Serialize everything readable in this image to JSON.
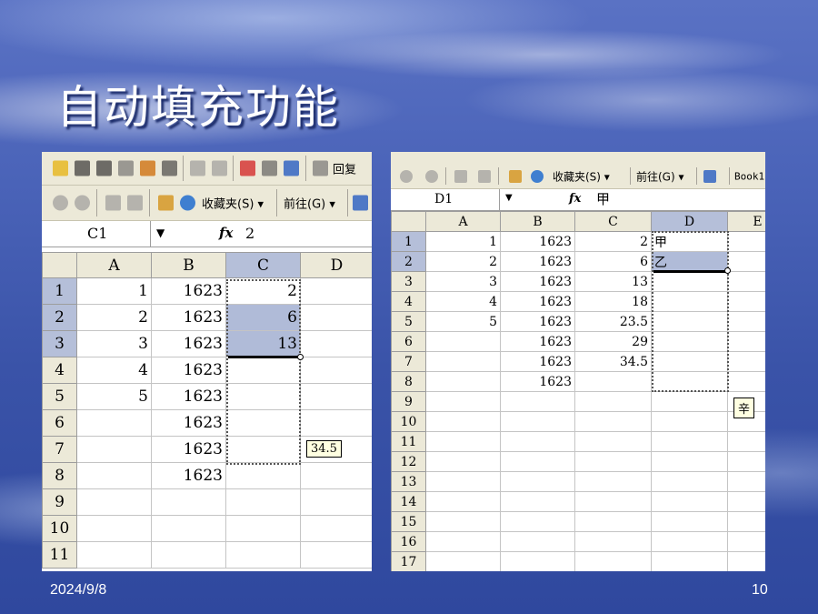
{
  "slide": {
    "title": "自动填充功能",
    "date": "2024/9/8",
    "page_number": "10"
  },
  "left_sheet": {
    "toolbar_icons": [
      "folder-icon",
      "save-icon",
      "permission-icon",
      "mail-icon",
      "print-icon",
      "preview-icon",
      "undo-icon",
      "redo-icon",
      "spellcheck-icon",
      "paste-icon",
      "table-icon",
      "reply-icon"
    ],
    "toolbar_text_right": "回复",
    "web_toolbar": {
      "favorites": "收藏夹(S) ▾",
      "goto": "前往(G) ▾"
    },
    "name_box": "C1",
    "formula_value": "2",
    "columns": [
      "A",
      "B",
      "C",
      "D"
    ],
    "rows": [
      {
        "n": "1",
        "a": "1",
        "b": "1623",
        "c": "2"
      },
      {
        "n": "2",
        "a": "2",
        "b": "1623",
        "c": "6"
      },
      {
        "n": "3",
        "a": "3",
        "b": "1623",
        "c": "13"
      },
      {
        "n": "4",
        "a": "4",
        "b": "1623",
        "c": ""
      },
      {
        "n": "5",
        "a": "5",
        "b": "1623",
        "c": ""
      },
      {
        "n": "6",
        "a": "",
        "b": "1623",
        "c": ""
      },
      {
        "n": "7",
        "a": "",
        "b": "1623",
        "c": ""
      },
      {
        "n": "8",
        "a": "",
        "b": "1623",
        "c": ""
      },
      {
        "n": "9",
        "a": "",
        "b": "",
        "c": ""
      },
      {
        "n": "10",
        "a": "",
        "b": "",
        "c": ""
      },
      {
        "n": "11",
        "a": "",
        "b": "",
        "c": ""
      }
    ],
    "fill_tooltip": "34.5"
  },
  "right_sheet": {
    "web_toolbar": {
      "favorites": "收藏夹(S) ▾",
      "goto": "前往(G) ▾",
      "book": "Book1"
    },
    "name_box": "D1",
    "formula_value": "甲",
    "columns": [
      "A",
      "B",
      "C",
      "D",
      "E"
    ],
    "rows": [
      {
        "n": "1",
        "a": "1",
        "b": "1623",
        "c": "2",
        "d": "甲"
      },
      {
        "n": "2",
        "a": "2",
        "b": "1623",
        "c": "6",
        "d": "乙"
      },
      {
        "n": "3",
        "a": "3",
        "b": "1623",
        "c": "13",
        "d": ""
      },
      {
        "n": "4",
        "a": "4",
        "b": "1623",
        "c": "18",
        "d": ""
      },
      {
        "n": "5",
        "a": "5",
        "b": "1623",
        "c": "23.5",
        "d": ""
      },
      {
        "n": "6",
        "a": "",
        "b": "1623",
        "c": "29",
        "d": ""
      },
      {
        "n": "7",
        "a": "",
        "b": "1623",
        "c": "34.5",
        "d": ""
      },
      {
        "n": "8",
        "a": "",
        "b": "1623",
        "c": "",
        "d": ""
      },
      {
        "n": "9",
        "a": "",
        "b": "",
        "c": "",
        "d": ""
      },
      {
        "n": "10",
        "a": "",
        "b": "",
        "c": "",
        "d": ""
      },
      {
        "n": "11",
        "a": "",
        "b": "",
        "c": "",
        "d": ""
      },
      {
        "n": "12",
        "a": "",
        "b": "",
        "c": "",
        "d": ""
      },
      {
        "n": "13",
        "a": "",
        "b": "",
        "c": "",
        "d": ""
      },
      {
        "n": "14",
        "a": "",
        "b": "",
        "c": "",
        "d": ""
      },
      {
        "n": "15",
        "a": "",
        "b": "",
        "c": "",
        "d": ""
      },
      {
        "n": "16",
        "a": "",
        "b": "",
        "c": "",
        "d": ""
      },
      {
        "n": "17",
        "a": "",
        "b": "",
        "c": "",
        "d": ""
      }
    ],
    "fill_tooltip": "辛"
  }
}
